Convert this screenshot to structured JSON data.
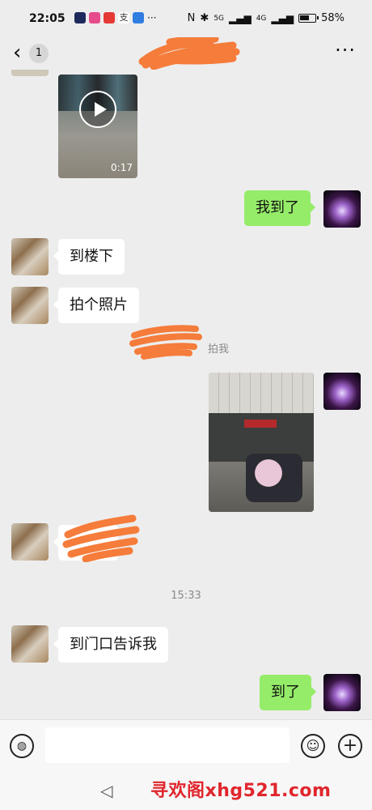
{
  "status_bar": {
    "time": "22:05",
    "battery": "58%",
    "signal_labels": [
      "5G",
      "4G"
    ]
  },
  "header": {
    "back_glyph": "‹",
    "unread_count": "1",
    "more_glyph": "···"
  },
  "messages": {
    "video": {
      "duration": "0:17"
    },
    "m1": {
      "text": "我到了"
    },
    "m2": {
      "text": "到楼下"
    },
    "m3": {
      "text": "拍个照片"
    },
    "system_pat": {
      "visible_suffix": "拍我"
    },
    "time_divider": "15:33",
    "m5": {
      "text": "到门口告诉我"
    },
    "m6": {
      "text": "到了"
    }
  },
  "input_bar": {
    "voice_icon": "voice-icon",
    "emoji_icon": "emoji-icon",
    "plus_icon": "plus-icon",
    "placeholder": ""
  },
  "watermark": "寻欢阁xhg521.com",
  "colors": {
    "background": "#ededed",
    "outgoing_bubble": "#95ec69",
    "incoming_bubble": "#ffffff",
    "scribble": "#f57c3a",
    "watermark": "#e0262d"
  }
}
